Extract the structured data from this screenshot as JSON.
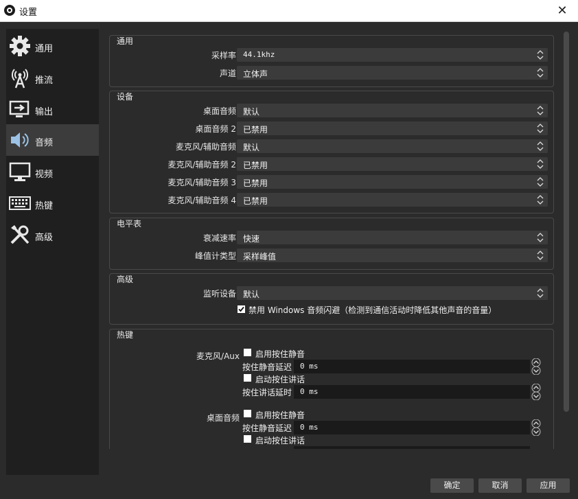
{
  "window": {
    "title": "设置"
  },
  "sidebar": {
    "items": [
      {
        "label": "通用",
        "icon": "gear-icon"
      },
      {
        "label": "推流",
        "icon": "broadcast-icon"
      },
      {
        "label": "输出",
        "icon": "output-icon"
      },
      {
        "label": "音频",
        "icon": "speaker-icon"
      },
      {
        "label": "视频",
        "icon": "monitor-icon"
      },
      {
        "label": "热键",
        "icon": "keyboard-icon"
      },
      {
        "label": "高级",
        "icon": "tools-icon"
      }
    ],
    "active": "音频"
  },
  "general": {
    "title": "通用",
    "sample_rate_label": "采样率",
    "sample_rate_value": "44.1khz",
    "channels_label": "声道",
    "channels_value": "立体声"
  },
  "devices": {
    "title": "设备",
    "rows": [
      {
        "label": "桌面音频",
        "value": "默认"
      },
      {
        "label": "桌面音频 2",
        "value": "已禁用"
      },
      {
        "label": "麦克风/辅助音频",
        "value": "默认"
      },
      {
        "label": "麦克风/辅助音频 2",
        "value": "已禁用"
      },
      {
        "label": "麦克风/辅助音频 3",
        "value": "已禁用"
      },
      {
        "label": "麦克风/辅助音频 4",
        "value": "已禁用"
      }
    ]
  },
  "meters": {
    "title": "电平表",
    "decay_label": "衰减速率",
    "decay_value": "快速",
    "peak_label": "峰值计类型",
    "peak_value": "采样峰值"
  },
  "advanced": {
    "title": "高级",
    "monitor_label": "监听设备",
    "monitor_value": "默认",
    "ducking_label": "禁用 Windows 音频闪避（检测到通信活动时降低其他声音的音量）",
    "ducking_checked": true
  },
  "hotkeys": {
    "title": "热键",
    "mic_label": "麦克风/Aux",
    "desktop_label": "桌面音频",
    "enable_ptm": "启用按住静音",
    "ptm_delay": "按住静音延迟",
    "enable_ptt": "启动按住讲话",
    "ptt_delay": "按住讲话延时",
    "delay_value": "0 ms"
  },
  "buttons": {
    "ok": "确定",
    "cancel": "取消",
    "apply": "应用"
  }
}
